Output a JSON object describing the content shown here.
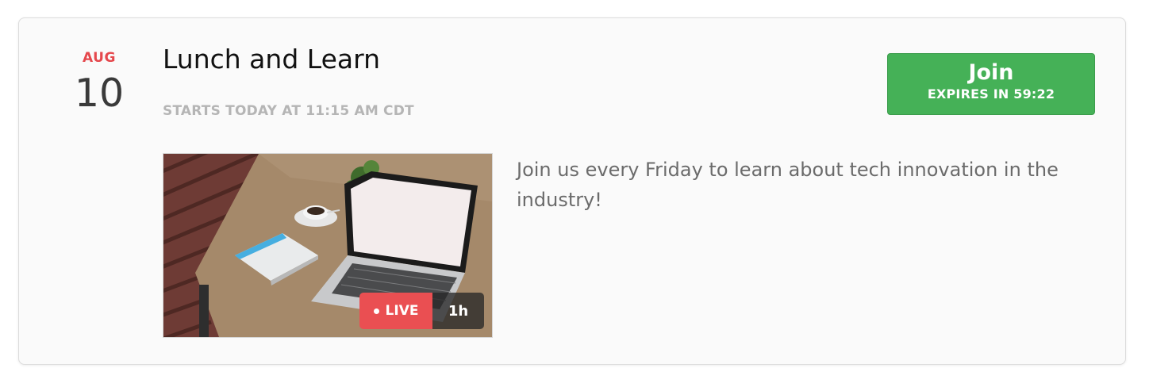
{
  "event": {
    "month": "AUG",
    "day": "10",
    "title": "Lunch and Learn",
    "start_info": "STARTS TODAY AT 11:15 AM CDT",
    "description": "Join us every Friday to learn about tech innovation in the industry!"
  },
  "join_button": {
    "label": "Join",
    "expiry": "EXPIRES IN 59:22"
  },
  "thumbnail": {
    "live_label": "LIVE",
    "duration": "1h"
  },
  "colors": {
    "accent_red": "#e5484d",
    "join_green": "#45b157",
    "card_bg": "#fafafa"
  }
}
